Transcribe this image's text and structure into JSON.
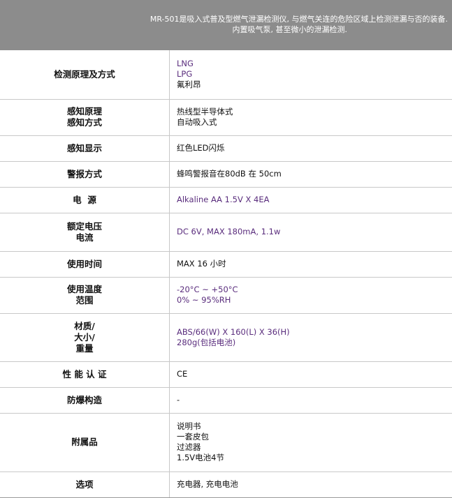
{
  "header": {
    "line1": "MR-501是吸入式普及型燃气泄漏检测仪, 与燃气关连的危险区域上检测泄漏与否的装备.",
    "line2": "内置吸气泵, 甚至微小的泄漏检测."
  },
  "rows": [
    {
      "label": [
        "检测原理及方式"
      ],
      "value": [
        "LNG",
        "LPG",
        "氟利昂"
      ]
    },
    {
      "label": [
        "感知原理",
        "感知方式"
      ],
      "value": [
        "热线型半导体式",
        "自动吸入式"
      ]
    },
    {
      "label": [
        "感知显示"
      ],
      "value": [
        "红色LED闪烁"
      ]
    },
    {
      "label": [
        "警报方式"
      ],
      "value": [
        "蜂鸣警报音在80dB 在 50cm"
      ]
    },
    {
      "label": [
        "电  源"
      ],
      "value": [
        "Alkaline AA 1.5V X 4EA"
      ]
    },
    {
      "label": [
        "额定电压",
        "电流"
      ],
      "value": [
        "DC 6V, MAX 180mA, 1.1w"
      ]
    },
    {
      "label": [
        "使用时间"
      ],
      "value": [
        "MAX 16 小时"
      ]
    },
    {
      "label": [
        "使用温度",
        "范围"
      ],
      "value": [
        "-20°C ~ +50°C",
        "0% ~ 95%RH"
      ]
    },
    {
      "label": [
        "材质/",
        "大小/",
        "重量"
      ],
      "value": [
        "ABS/66(W) X 160(L) X 36(H)",
        "280g(包括电池)"
      ]
    },
    {
      "label": [
        "性 能 认 证"
      ],
      "value": [
        "CE"
      ]
    },
    {
      "label": [
        "防爆构造"
      ],
      "value": [
        "-"
      ]
    },
    {
      "label": [
        "附属品"
      ],
      "value": [
        "说明书",
        "一套皮包",
        "过滤器",
        "1.5V电池4节"
      ]
    },
    {
      "label": [
        "选项"
      ],
      "value": [
        "充电器, 充电电池"
      ]
    }
  ]
}
